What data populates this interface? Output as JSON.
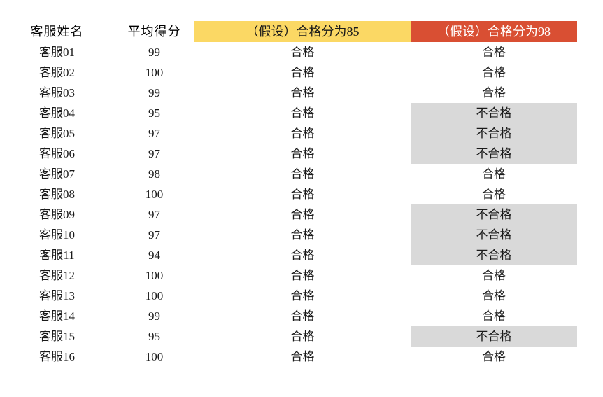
{
  "table": {
    "columns": [
      {
        "key": "name",
        "label": "客服姓名",
        "style": "plain"
      },
      {
        "key": "score",
        "label": "平均得分",
        "style": "plain"
      },
      {
        "key": "t85",
        "label": "（假设）合格分为85",
        "style": "yellow"
      },
      {
        "key": "t98",
        "label": "（假设）合格分为98",
        "style": "red"
      }
    ],
    "rows": [
      {
        "name": "客服01",
        "score": "99",
        "t85": "合格",
        "t98": "合格",
        "t98_highlight": false
      },
      {
        "name": "客服02",
        "score": "100",
        "t85": "合格",
        "t98": "合格",
        "t98_highlight": false
      },
      {
        "name": "客服03",
        "score": "99",
        "t85": "合格",
        "t98": "合格",
        "t98_highlight": false
      },
      {
        "name": "客服04",
        "score": "95",
        "t85": "合格",
        "t98": "不合格",
        "t98_highlight": true
      },
      {
        "name": "客服05",
        "score": "97",
        "t85": "合格",
        "t98": "不合格",
        "t98_highlight": true
      },
      {
        "name": "客服06",
        "score": "97",
        "t85": "合格",
        "t98": "不合格",
        "t98_highlight": true
      },
      {
        "name": "客服07",
        "score": "98",
        "t85": "合格",
        "t98": "合格",
        "t98_highlight": false
      },
      {
        "name": "客服08",
        "score": "100",
        "t85": "合格",
        "t98": "合格",
        "t98_highlight": false
      },
      {
        "name": "客服09",
        "score": "97",
        "t85": "合格",
        "t98": "不合格",
        "t98_highlight": true
      },
      {
        "name": "客服10",
        "score": "97",
        "t85": "合格",
        "t98": "不合格",
        "t98_highlight": true
      },
      {
        "name": "客服11",
        "score": "94",
        "t85": "合格",
        "t98": "不合格",
        "t98_highlight": true
      },
      {
        "name": "客服12",
        "score": "100",
        "t85": "合格",
        "t98": "合格",
        "t98_highlight": false
      },
      {
        "name": "客服13",
        "score": "100",
        "t85": "合格",
        "t98": "合格",
        "t98_highlight": false
      },
      {
        "name": "客服14",
        "score": "99",
        "t85": "合格",
        "t98": "合格",
        "t98_highlight": false
      },
      {
        "name": "客服15",
        "score": "95",
        "t85": "合格",
        "t98": "不合格",
        "t98_highlight": true
      },
      {
        "name": "客服16",
        "score": "100",
        "t85": "合格",
        "t98": "合格",
        "t98_highlight": false
      }
    ]
  },
  "colors": {
    "header_yellow": "#fbd864",
    "header_red": "#d94f33",
    "header_red_text": "#ffffff",
    "highlight_gray": "#d9d9d9",
    "text": "#1a1a1a",
    "background": "#ffffff"
  }
}
